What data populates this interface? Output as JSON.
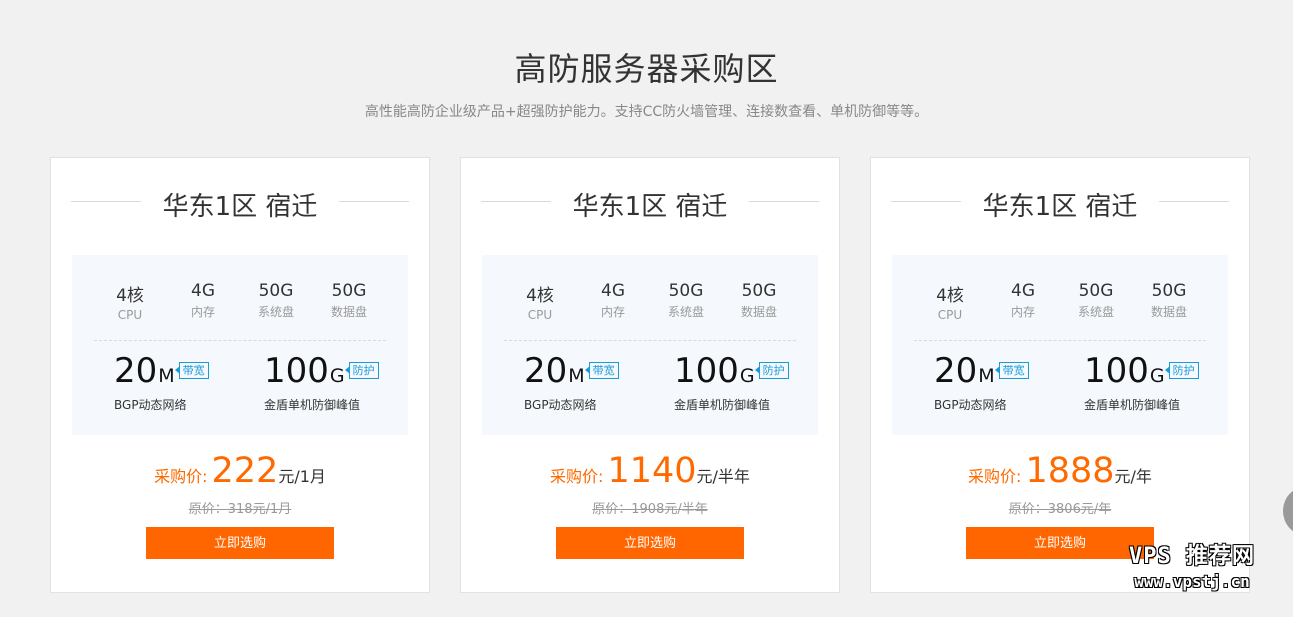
{
  "page": {
    "title": "高防服务器采购区",
    "subtitle": "高性能高防企业级产品+超强防护能力。支持CC防火墙管理、连接数查看、单机防御等等。"
  },
  "colors": {
    "accent": "#ff6600",
    "tag": "#1a9bd8",
    "background": "#f1f1f1"
  },
  "cards": [
    {
      "title": "华东1区 宿迁",
      "specs": [
        {
          "value": "4核",
          "label": "CPU"
        },
        {
          "value": "4G",
          "label": "内存"
        },
        {
          "value": "50G",
          "label": "系统盘"
        },
        {
          "value": "50G",
          "label": "数据盘"
        }
      ],
      "bandwidth": {
        "num": "20",
        "unit": "M",
        "tag": "带宽",
        "desc": "BGP动态网络"
      },
      "defense": {
        "num": "100",
        "unit": "G",
        "tag": "防护",
        "desc": "金盾单机防御峰值"
      },
      "price_label": "采购价:",
      "price": "222",
      "price_unit": "元/1月",
      "original": "原价：318元/1月",
      "button": "立即选购"
    },
    {
      "title": "华东1区 宿迁",
      "specs": [
        {
          "value": "4核",
          "label": "CPU"
        },
        {
          "value": "4G",
          "label": "内存"
        },
        {
          "value": "50G",
          "label": "系统盘"
        },
        {
          "value": "50G",
          "label": "数据盘"
        }
      ],
      "bandwidth": {
        "num": "20",
        "unit": "M",
        "tag": "带宽",
        "desc": "BGP动态网络"
      },
      "defense": {
        "num": "100",
        "unit": "G",
        "tag": "防护",
        "desc": "金盾单机防御峰值"
      },
      "price_label": "采购价:",
      "price": "1140",
      "price_unit": "元/半年",
      "original": "原价：1908元/半年",
      "button": "立即选购"
    },
    {
      "title": "华东1区 宿迁",
      "specs": [
        {
          "value": "4核",
          "label": "CPU"
        },
        {
          "value": "4G",
          "label": "内存"
        },
        {
          "value": "50G",
          "label": "系统盘"
        },
        {
          "value": "50G",
          "label": "数据盘"
        }
      ],
      "bandwidth": {
        "num": "20",
        "unit": "M",
        "tag": "带宽",
        "desc": "BGP动态网络"
      },
      "defense": {
        "num": "100",
        "unit": "G",
        "tag": "防护",
        "desc": "金盾单机防御峰值"
      },
      "price_label": "采购价:",
      "price": "1888",
      "price_unit": "元/年",
      "original": "原价：3806元/年",
      "button": "立即选购"
    }
  ],
  "watermark": {
    "line1": "VPS 推荐网",
    "line2": "www.vpstj.cn"
  }
}
